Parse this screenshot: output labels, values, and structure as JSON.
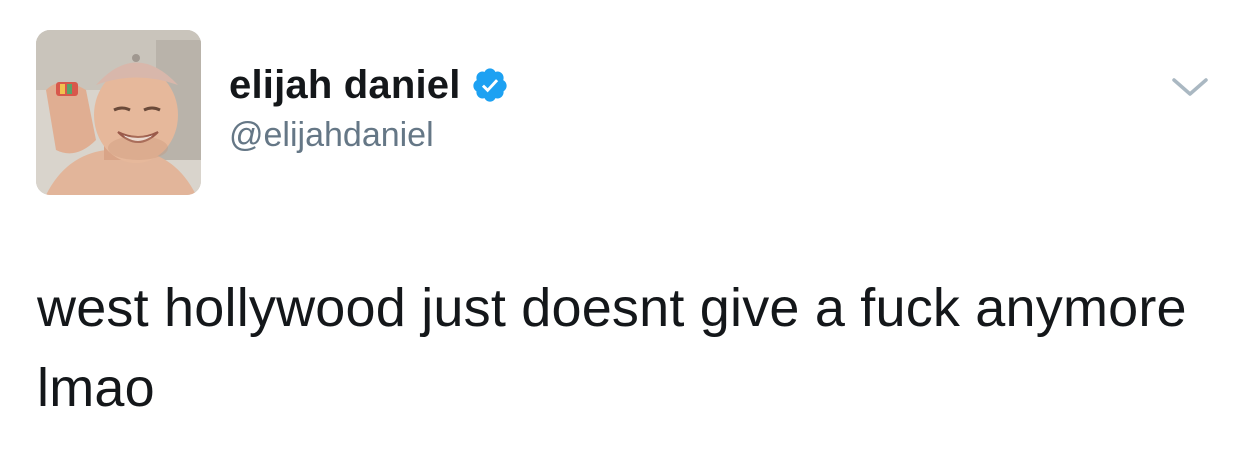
{
  "tweet": {
    "author": {
      "display_name": "elijah daniel",
      "handle": "@elijahdaniel",
      "verified": true,
      "avatar_icon": "profile-photo"
    },
    "text": "west hollywood just doesnt give a fuck anymore lmao",
    "menu_icon": "chevron-down-icon"
  },
  "colors": {
    "verified_badge": "#1da1f2",
    "handle_text": "#657786",
    "primary_text": "#14171a",
    "chevron": "#aab8c2"
  }
}
